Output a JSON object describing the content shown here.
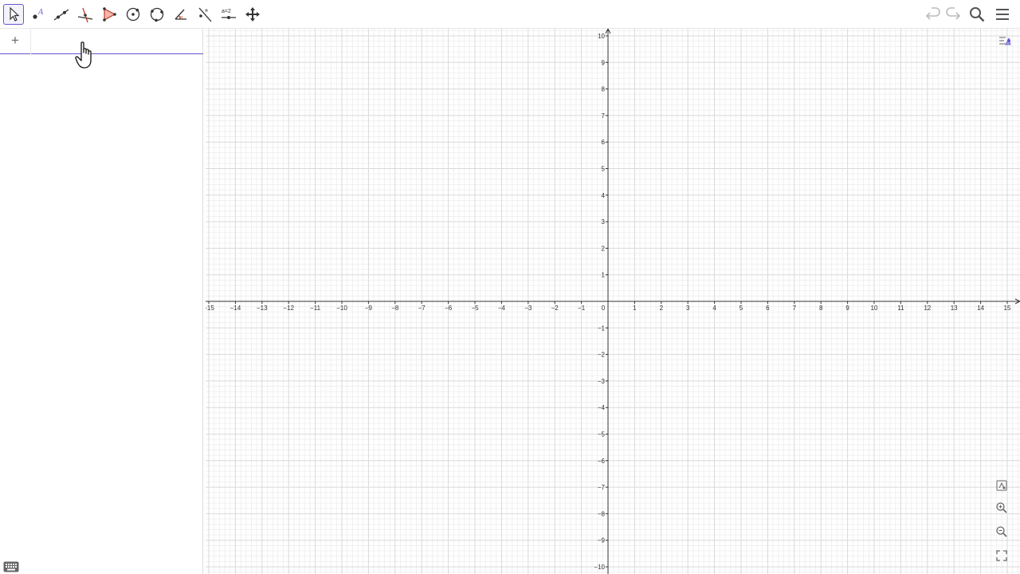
{
  "toolbar": {
    "tools": [
      {
        "name": "move-tool",
        "icon": "arrow-pointer-icon"
      },
      {
        "name": "point-tool",
        "icon": "point-icon"
      },
      {
        "name": "line-tool",
        "icon": "line-icon"
      },
      {
        "name": "perpendicular-tool",
        "icon": "perpendicular-icon"
      },
      {
        "name": "polygon-tool",
        "icon": "polygon-icon"
      },
      {
        "name": "circle-tool",
        "icon": "circle-center-icon"
      },
      {
        "name": "circle-three-points-tool",
        "icon": "circle-three-points-icon"
      },
      {
        "name": "angle-tool",
        "icon": "angle-icon"
      },
      {
        "name": "reflect-tool",
        "icon": "reflect-icon"
      },
      {
        "name": "slider-tool",
        "icon": "slider-icon",
        "label": "a=2"
      },
      {
        "name": "move-graphics-tool",
        "icon": "move-graphics-icon"
      }
    ],
    "selected_tool": "move-tool",
    "right": [
      "undo-icon",
      "redo-icon",
      "search-icon",
      "menu-icon"
    ]
  },
  "algebra": {
    "add_label": "+",
    "input_value": "",
    "input_placeholder": ""
  },
  "graphics": {
    "x_range": [
      -15,
      15
    ],
    "y_range": [
      -10,
      10
    ],
    "grid": true,
    "minor_grid": true,
    "x_ticks": [
      "−15",
      "−14",
      "−13",
      "−12",
      "−11",
      "−10",
      "−9",
      "−8",
      "−7",
      "−6",
      "−5",
      "−4",
      "−3",
      "−2",
      "−1",
      "0",
      "1",
      "2",
      "3",
      "4",
      "5",
      "6",
      "7",
      "8",
      "9",
      "10",
      "11",
      "12",
      "13",
      "14",
      "15"
    ],
    "y_ticks": [
      "10",
      "9",
      "8",
      "7",
      "6",
      "5",
      "4",
      "3",
      "2",
      "1",
      "−1",
      "−2",
      "−3",
      "−4",
      "−5",
      "−6",
      "−7",
      "−8",
      "−9",
      "−10"
    ],
    "buttons": [
      "style-bar-icon",
      "home-icon",
      "zoom-in-icon",
      "zoom-out-icon",
      "fullscreen-icon"
    ]
  },
  "colors": {
    "accent": "#6557d2",
    "grid_major": "#d9d9d9",
    "grid_minor": "#f0f0f0",
    "axis": "#333333"
  }
}
